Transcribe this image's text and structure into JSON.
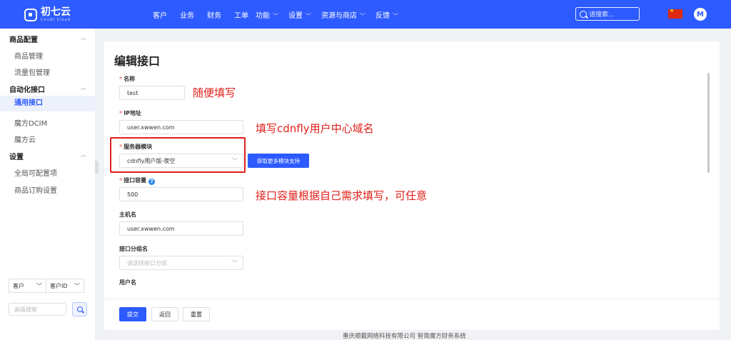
{
  "header": {
    "logo_cn": "初七云",
    "logo_en": "ChuQi Cloud",
    "nav": [
      "客户",
      "业务",
      "财务",
      "工单"
    ],
    "nav_dropdowns": [
      "功能",
      "设置",
      "资源与商店",
      "反馈"
    ],
    "search_placeholder": "请搜索...",
    "avatar_letter": "M"
  },
  "sidebar": {
    "groups": [
      {
        "label": "商品配置",
        "items": [
          "商品管理",
          "流量包管理"
        ]
      },
      {
        "label": "自动化接口",
        "items": [
          "通用接口",
          "魔方DCIM",
          "魔方云"
        ]
      },
      {
        "label": "设置",
        "items": [
          "全局可配置项",
          "商品订购设置"
        ]
      }
    ],
    "active_item": "通用接口",
    "filter_select_1": "客户",
    "filter_select_2": "客户ID",
    "search_placeholder": "高级搜索"
  },
  "form": {
    "title": "编辑接口",
    "name_label": "名称",
    "name_value": "test",
    "ip_label": "IP地址",
    "ip_value": "user.xwwen.com",
    "module_label": "服务器模块",
    "module_value": "cdnfly用户版-夜空",
    "more_modules_button": "获取更多模块支持",
    "capacity_label": "接口容量",
    "capacity_value": "500",
    "host_label": "主机名",
    "host_value": "user.xwwen.com",
    "group_label": "接口分组名",
    "group_placeholder": "请选择接口分组",
    "username_label": "用户名",
    "submit_button": "提交",
    "back_button": "返回",
    "reset_button": "重置"
  },
  "annotations": {
    "name_note": "随便填写",
    "ip_note": "填写cdnfly用户中心域名",
    "capacity_note": "接口容量根据自己需求填写，可任意"
  },
  "footer": "重庆顺戴网络科技有限公司 智简魔方财务系统",
  "colors": {
    "primary": "#2d5bff",
    "annotation": "#e0201a",
    "required": "#f56c6c"
  }
}
